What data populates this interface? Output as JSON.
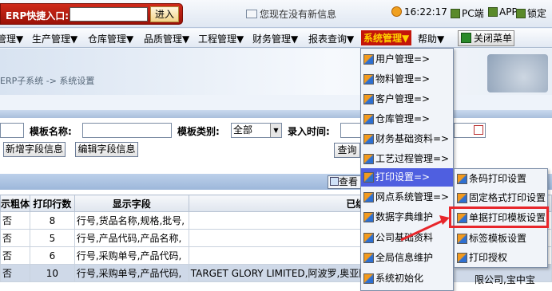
{
  "topbar": {
    "erp_label": "ERP快捷入口:",
    "erp_input_value": "",
    "enter_button": "进入",
    "message_text": "您现在没有新信息",
    "clock": "16:22:17",
    "pc_label": "PC端",
    "app_label": "APP",
    "lock_label": "锁定"
  },
  "menu": {
    "items": [
      "管理▼",
      "生产管理▼",
      "仓库管理▼",
      "品质管理▼",
      "工程管理▼",
      "财务管理▼",
      "报表查询▼",
      "系统管理▼",
      "帮助▼"
    ],
    "close_menu": "关闭菜单"
  },
  "breadcrumb": "ERP子系统 -> 系统设置",
  "filters": {
    "template_name_label": "模板名称:",
    "template_name_value": "",
    "template_type_label": "模板类别:",
    "template_type_value": "全部",
    "entry_time_label": "录入时间:",
    "entry_time_value": "",
    "add_field_button": "新增字段信息",
    "edit_field_button": "编辑字段信息",
    "query_button": "查询",
    "view_button": "查看"
  },
  "table": {
    "headers": [
      "示粗体",
      "打印行数",
      "显示字段",
      "已绑定客户"
    ],
    "rows": [
      [
        "否",
        "8",
        "行号,货品名称,规格,批号,",
        ""
      ],
      [
        "否",
        "5",
        "行号,产品代码,产品名称,",
        ""
      ],
      [
        "否",
        "6",
        "行号,采购单号,产品代码,",
        ""
      ],
      [
        "否",
        "10",
        "行号,采购单号,产品代码,",
        "TARGET  GLORY  LIMITED,阿波罗,奥亚图"
      ]
    ]
  },
  "dropdown": {
    "items": [
      "用户管理=>",
      "物料管理=>",
      "客户管理=>",
      "仓库管理=>",
      "财务基础资料=>",
      "工艺过程管理=>",
      "打印设置=>",
      "网点系统管理=>",
      "数据字典维护",
      "公司基础资料",
      "全局信息维护",
      "系统初始化"
    ],
    "highlighted_index": 6
  },
  "submenu": {
    "items": [
      "条码打印设置",
      "固定格式打印设置",
      "单据打印模板设置",
      "标签模板设置",
      "打印授权"
    ],
    "emphasized_index": 2
  },
  "right_edge_text": "限公司,宝中宝",
  "colors": {
    "menu_active_bg": "#c4160a",
    "menu_active_fg": "#ffd200",
    "highlight": "#4f5fe0",
    "callout": "#e8262b"
  }
}
